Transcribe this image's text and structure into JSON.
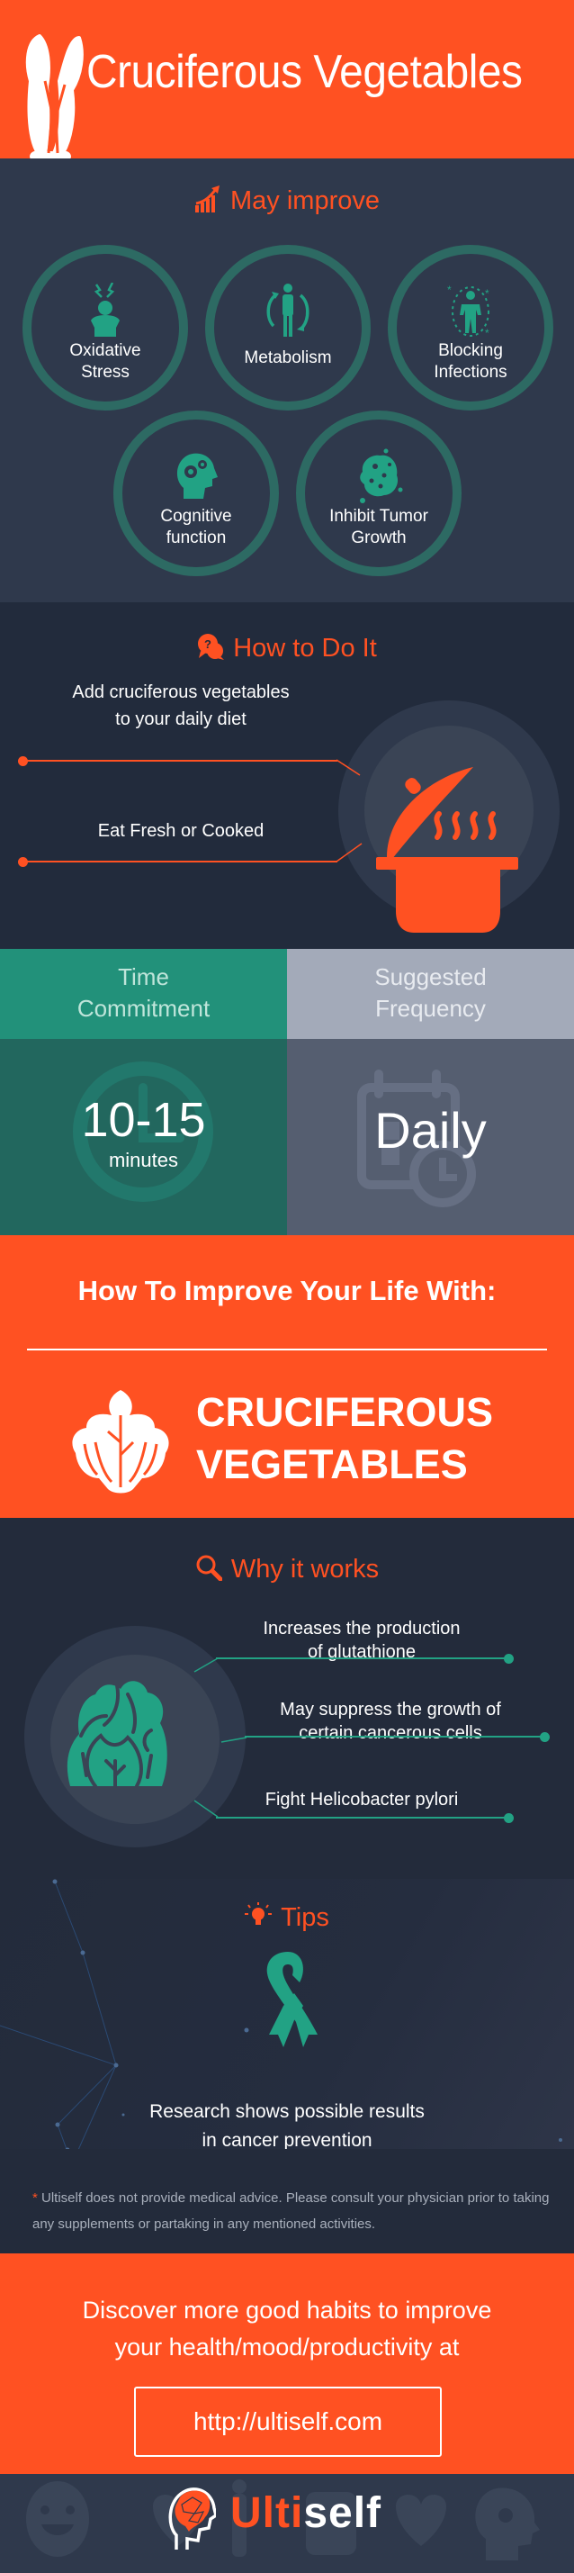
{
  "header": {
    "title": "Cruciferous Vegetables",
    "icon": "bok-choy-icon"
  },
  "may_improve": {
    "title": "May improve",
    "title_icon": "growth-chart-icon",
    "items": [
      {
        "label_line1": "Oxidative",
        "label_line2": "Stress",
        "icon": "stressed-person-icon"
      },
      {
        "label_line1": "Metabolism",
        "label_line2": "",
        "icon": "metabolism-person-icon"
      },
      {
        "label_line1": "Blocking",
        "label_line2": "Infections",
        "icon": "immune-person-icon"
      },
      {
        "label_line1": "Cognitive",
        "label_line2": "function",
        "icon": "brain-gears-icon"
      },
      {
        "label_line1": "Inhibit Tumor",
        "label_line2": "Growth",
        "icon": "tumor-cell-icon"
      }
    ]
  },
  "how_to": {
    "title": "How to Do It",
    "title_icon": "question-bubbles-icon",
    "steps": [
      {
        "line1": "Add cruciferous vegetables",
        "line2": "to your daily diet"
      },
      {
        "line1": "Eat Fresh or Cooked",
        "line2": ""
      }
    ],
    "illustration": "cooking-pot-icon"
  },
  "commitment": {
    "time": {
      "header_line1": "Time",
      "header_line2": "Commitment",
      "value": "10-15",
      "unit": "minutes"
    },
    "frequency": {
      "header_line1": "Suggested",
      "header_line2": "Frequency",
      "value": "Daily"
    }
  },
  "improve_life": {
    "title": "How To Improve Your Life With:",
    "subject_line1": "CRUCIFEROUS",
    "subject_line2": "VEGETABLES"
  },
  "why": {
    "title": "Why it works",
    "title_icon": "magnifier-icon",
    "reasons": [
      {
        "line1": "Increases the production",
        "line2": "of glutathione"
      },
      {
        "line1": "May suppress the growth of",
        "line2": "certain cancerous cells"
      },
      {
        "line1": "Fight Helicobacter pylori",
        "line2": ""
      }
    ]
  },
  "tips": {
    "title": "Tips",
    "title_icon": "lightbulb-icon",
    "line1": "Research shows possible results",
    "line2": "in cancer prevention"
  },
  "disclaimer": {
    "asterisk": "*",
    "text": "Ultiself does not provide medical advice. Please consult your physician prior to taking any supplements or partaking in any mentioned activities."
  },
  "cta": {
    "line1": "Discover more good habits to improve",
    "line2": "your health/mood/productivity at",
    "link": "http://ultiself.com"
  },
  "footer": {
    "brand_accent": "Ulti",
    "brand_rest": "self"
  },
  "colors": {
    "accent": "#ff5122",
    "teal": "#22a284",
    "dark": "#232b3b",
    "slate": "#2f394c"
  }
}
